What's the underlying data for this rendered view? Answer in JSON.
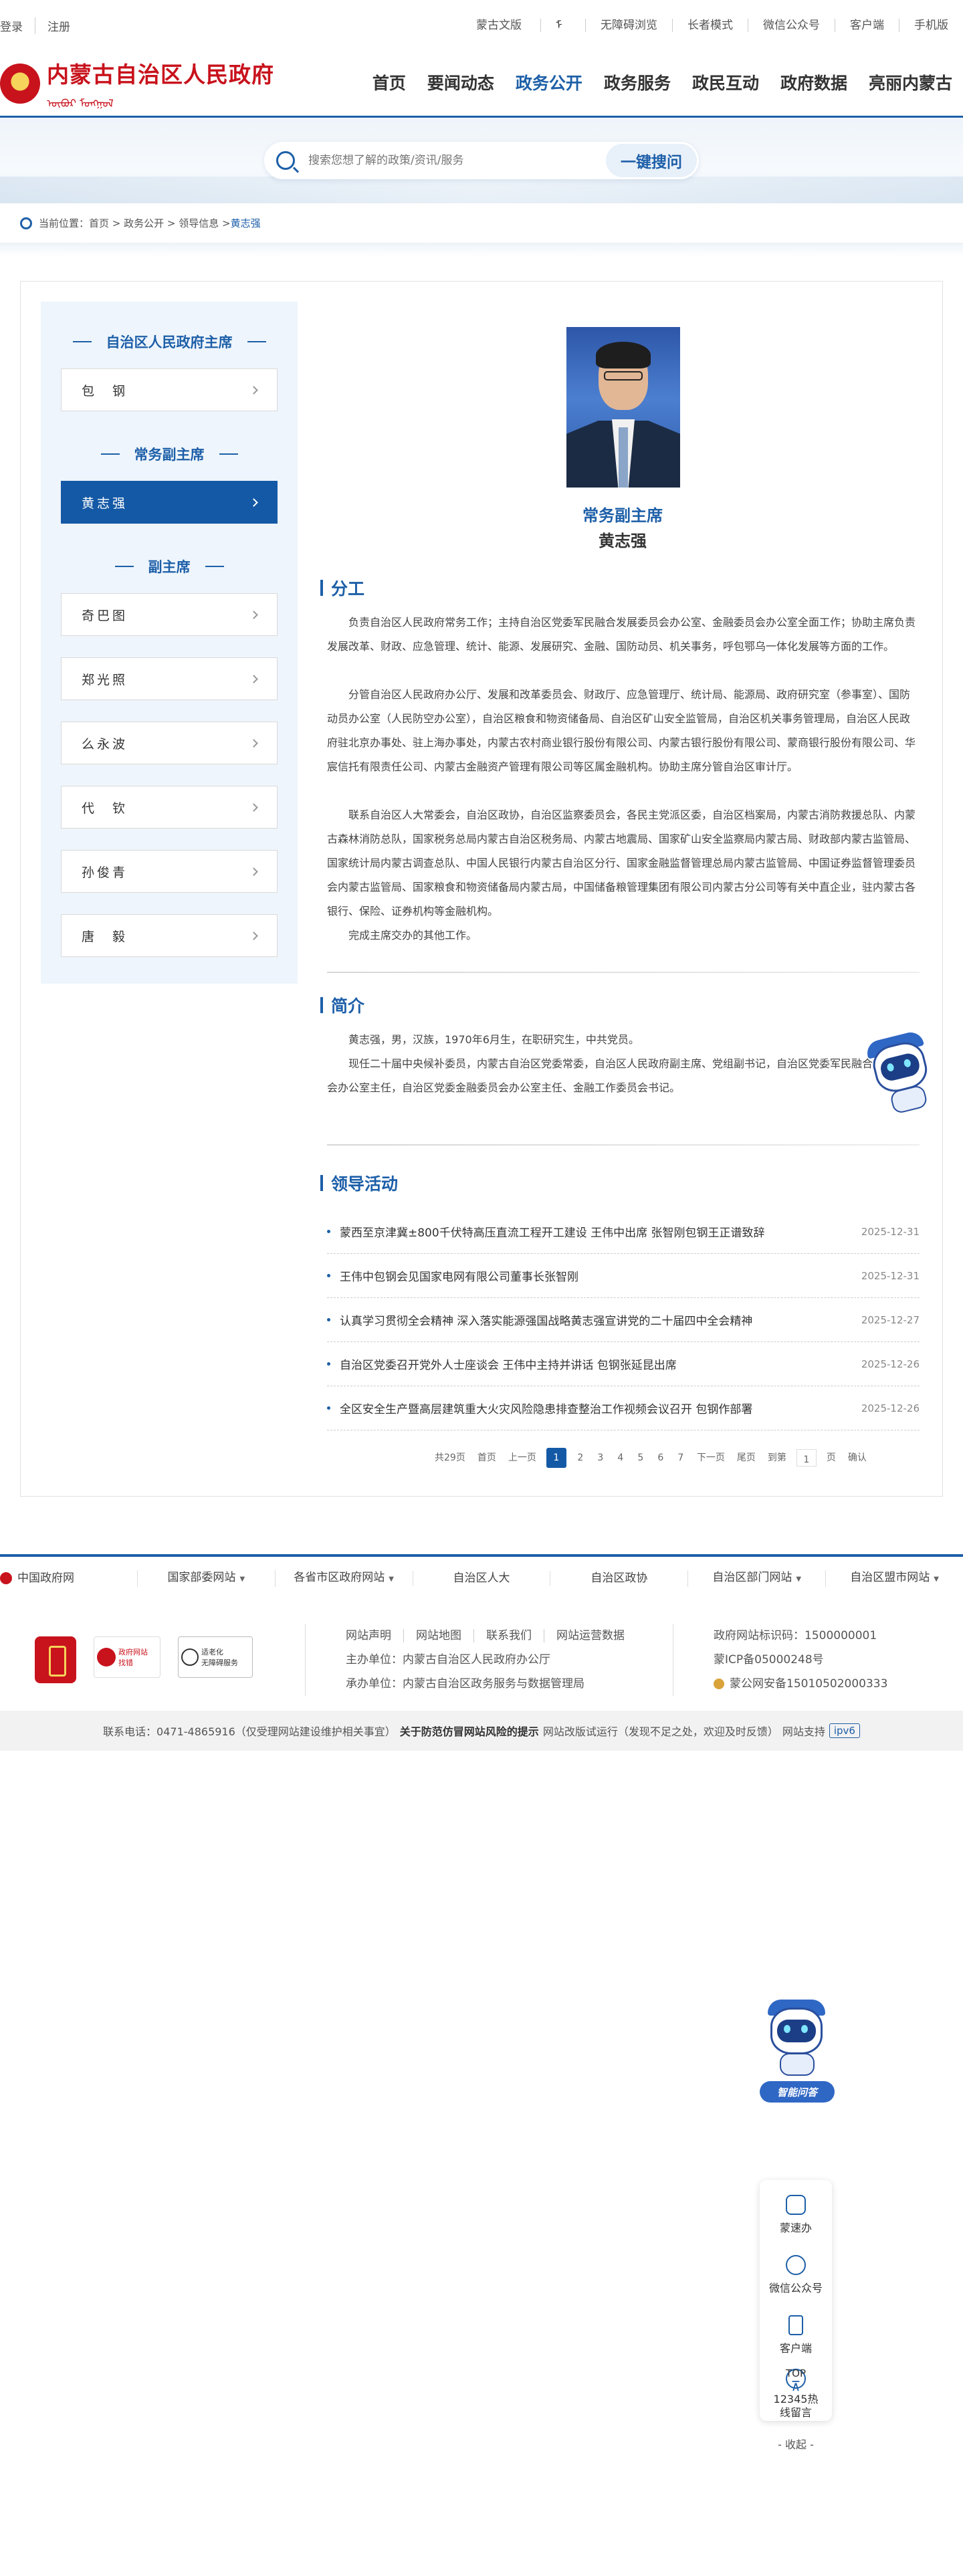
{
  "topbar": {
    "left": [
      "登录",
      "注册"
    ],
    "right": [
      "蒙古文版",
      "无障碍浏览",
      "长者模式",
      "微信公众号",
      "客户端",
      "手机版"
    ]
  },
  "logo": {
    "cn": "内蒙古自治区人民政府",
    "mn": "ᠥᠪᠥᠷ ᠮᠣᠩᠭᠣᠯ"
  },
  "nav": [
    "首页",
    "要闻动态",
    "政务公开",
    "政务服务",
    "政民互动",
    "政府数据",
    "亮丽内蒙古"
  ],
  "nav_active": "政务公开",
  "search": {
    "placeholder": "搜索您想了解的政策/资讯/服务",
    "button": "一键搜问"
  },
  "breadcrumb": {
    "prefix": "当前位置：",
    "path": "首页 > 政务公开 > 领导信息 > ",
    "current": "黄志强"
  },
  "sidebar": {
    "group1": "自治区人民政府主席",
    "group2": "常务副主席",
    "group3": "副主席",
    "items1": [
      "包　钢"
    ],
    "items2": [
      "黄志强"
    ],
    "items3": [
      "奇巴图",
      "郑光照",
      "么永波",
      "代　钦",
      "孙俊青",
      "唐　毅"
    ]
  },
  "profile": {
    "position": "常务副主席",
    "name": "黄志强"
  },
  "sections": {
    "duty": "分工",
    "intro": "简介",
    "activity": "领导活动"
  },
  "duty_paras": [
    "负责自治区人民政府常务工作；主持自治区党委军民融合发展委员会办公室、金融委员会办公室全面工作；协助主席负责发展改革、财政、应急管理、统计、能源、发展研究、金融、国防动员、机关事务，呼包鄂乌一体化发展等方面的工作。",
    "分管自治区人民政府办公厅、发展和改革委员会、财政厅、应急管理厅、统计局、能源局、政府研究室（参事室）、国防动员办公室（人民防空办公室），自治区粮食和物资储备局、自治区矿山安全监管局，自治区机关事务管理局，自治区人民政府驻北京办事处、驻上海办事处，内蒙古农村商业银行股份有限公司、内蒙古银行股份有限公司、蒙商银行股份有限公司、华宸信托有限责任公司、内蒙古金融资产管理有限公司等区属金融机构。协助主席分管自治区审计厅。",
    "联系自治区人大常委会，自治区政协，自治区监察委员会，各民主党派区委，自治区档案局，内蒙古消防救援总队、内蒙古森林消防总队，国家税务总局内蒙古自治区税务局、内蒙古地震局、国家矿山安全监察局内蒙古局、财政部内蒙古监管局、国家统计局内蒙古调查总队、中国人民银行内蒙古自治区分行、国家金融监督管理总局内蒙古监管局、中国证券监督管理委员会内蒙古监管局、国家粮食和物资储备局内蒙古局，中国储备粮管理集团有限公司内蒙古分公司等有关中直企业，驻内蒙古各银行、保险、证券机构等金融机构。",
    "完成主席交办的其他工作。"
  ],
  "intro_paras": [
    "黄志强，男，汉族，1970年6月生，在职研究生，中共党员。",
    "现任二十届中央候补委员，内蒙古自治区党委常委，自治区人民政府副主席、党组副书记，自治区党委军民融合发展委员会办公室主任，自治区党委金融委员会办公室主任、金融工作委员会书记。"
  ],
  "activities": [
    {
      "title": "蒙西至京津冀±800千伏特高压直流工程开工建设 王伟中出席 张智刚包钢王正谱致辞",
      "date": "2025-12-31"
    },
    {
      "title": "王伟中包钢会见国家电网有限公司董事长张智刚",
      "date": "2025-12-31"
    },
    {
      "title": "认真学习贯彻全会精神 深入落实能源强国战略黄志强宣讲党的二十届四中全会精神",
      "date": "2025-12-27"
    },
    {
      "title": "自治区党委召开党外人士座谈会 王伟中主持并讲话 包钢张延昆出席",
      "date": "2025-12-26"
    },
    {
      "title": "全区安全生产暨高层建筑重大火灾风险隐患排查整治工作视频会议召开 包钢作部署",
      "date": "2025-12-26"
    }
  ],
  "pager": {
    "total": "共29页",
    "first": "首页",
    "prev": "上一页",
    "pages": [
      "1",
      "2",
      "3",
      "4",
      "5",
      "6",
      "7"
    ],
    "current": "1",
    "next": "下一页",
    "last": "尾页",
    "goto": "到第",
    "goto_value": "1",
    "unit": "页",
    "confirm": "确认"
  },
  "footer_links": [
    "中国政府网",
    "国家部委网站",
    "各省市区政府网站",
    "自治区人大",
    "自治区政协",
    "自治区部门网站",
    "自治区盟市网站"
  ],
  "footer_badges": {
    "b2_line1": "政府网站",
    "b2_line2": "找错",
    "b3_line1": "适老化",
    "b3_line2": "无障碍服务"
  },
  "footer_info": {
    "row1": [
      "网站声明",
      "网站地图",
      "联系我们",
      "网站运营数据"
    ],
    "host": "主办单位：内蒙古自治区人民政府办公厅",
    "undertake": "承办单位：内蒙古自治区政务服务与数据管理局",
    "site_id": "政府网站标识码：1500000001",
    "icp": "蒙ICP备05000248号",
    "police": "蒙公网安备15010502000333"
  },
  "bottombar": {
    "phone": "联系电话：0471-4865916（仅受理网站建设维护相关事宜）",
    "warning": "关于防范仿冒网站风险的提示",
    "note": "网站改版试运行（发现不足之处，欢迎及时反馈）",
    "support": "网站支持",
    "ipv6": "ipv6"
  },
  "float_bar": {
    "badge": "智能问答",
    "items": [
      "蒙速办",
      "微信公众号",
      "客户端",
      "12345热线留言",
      "TOP"
    ],
    "collapse": "- 收起 -"
  }
}
